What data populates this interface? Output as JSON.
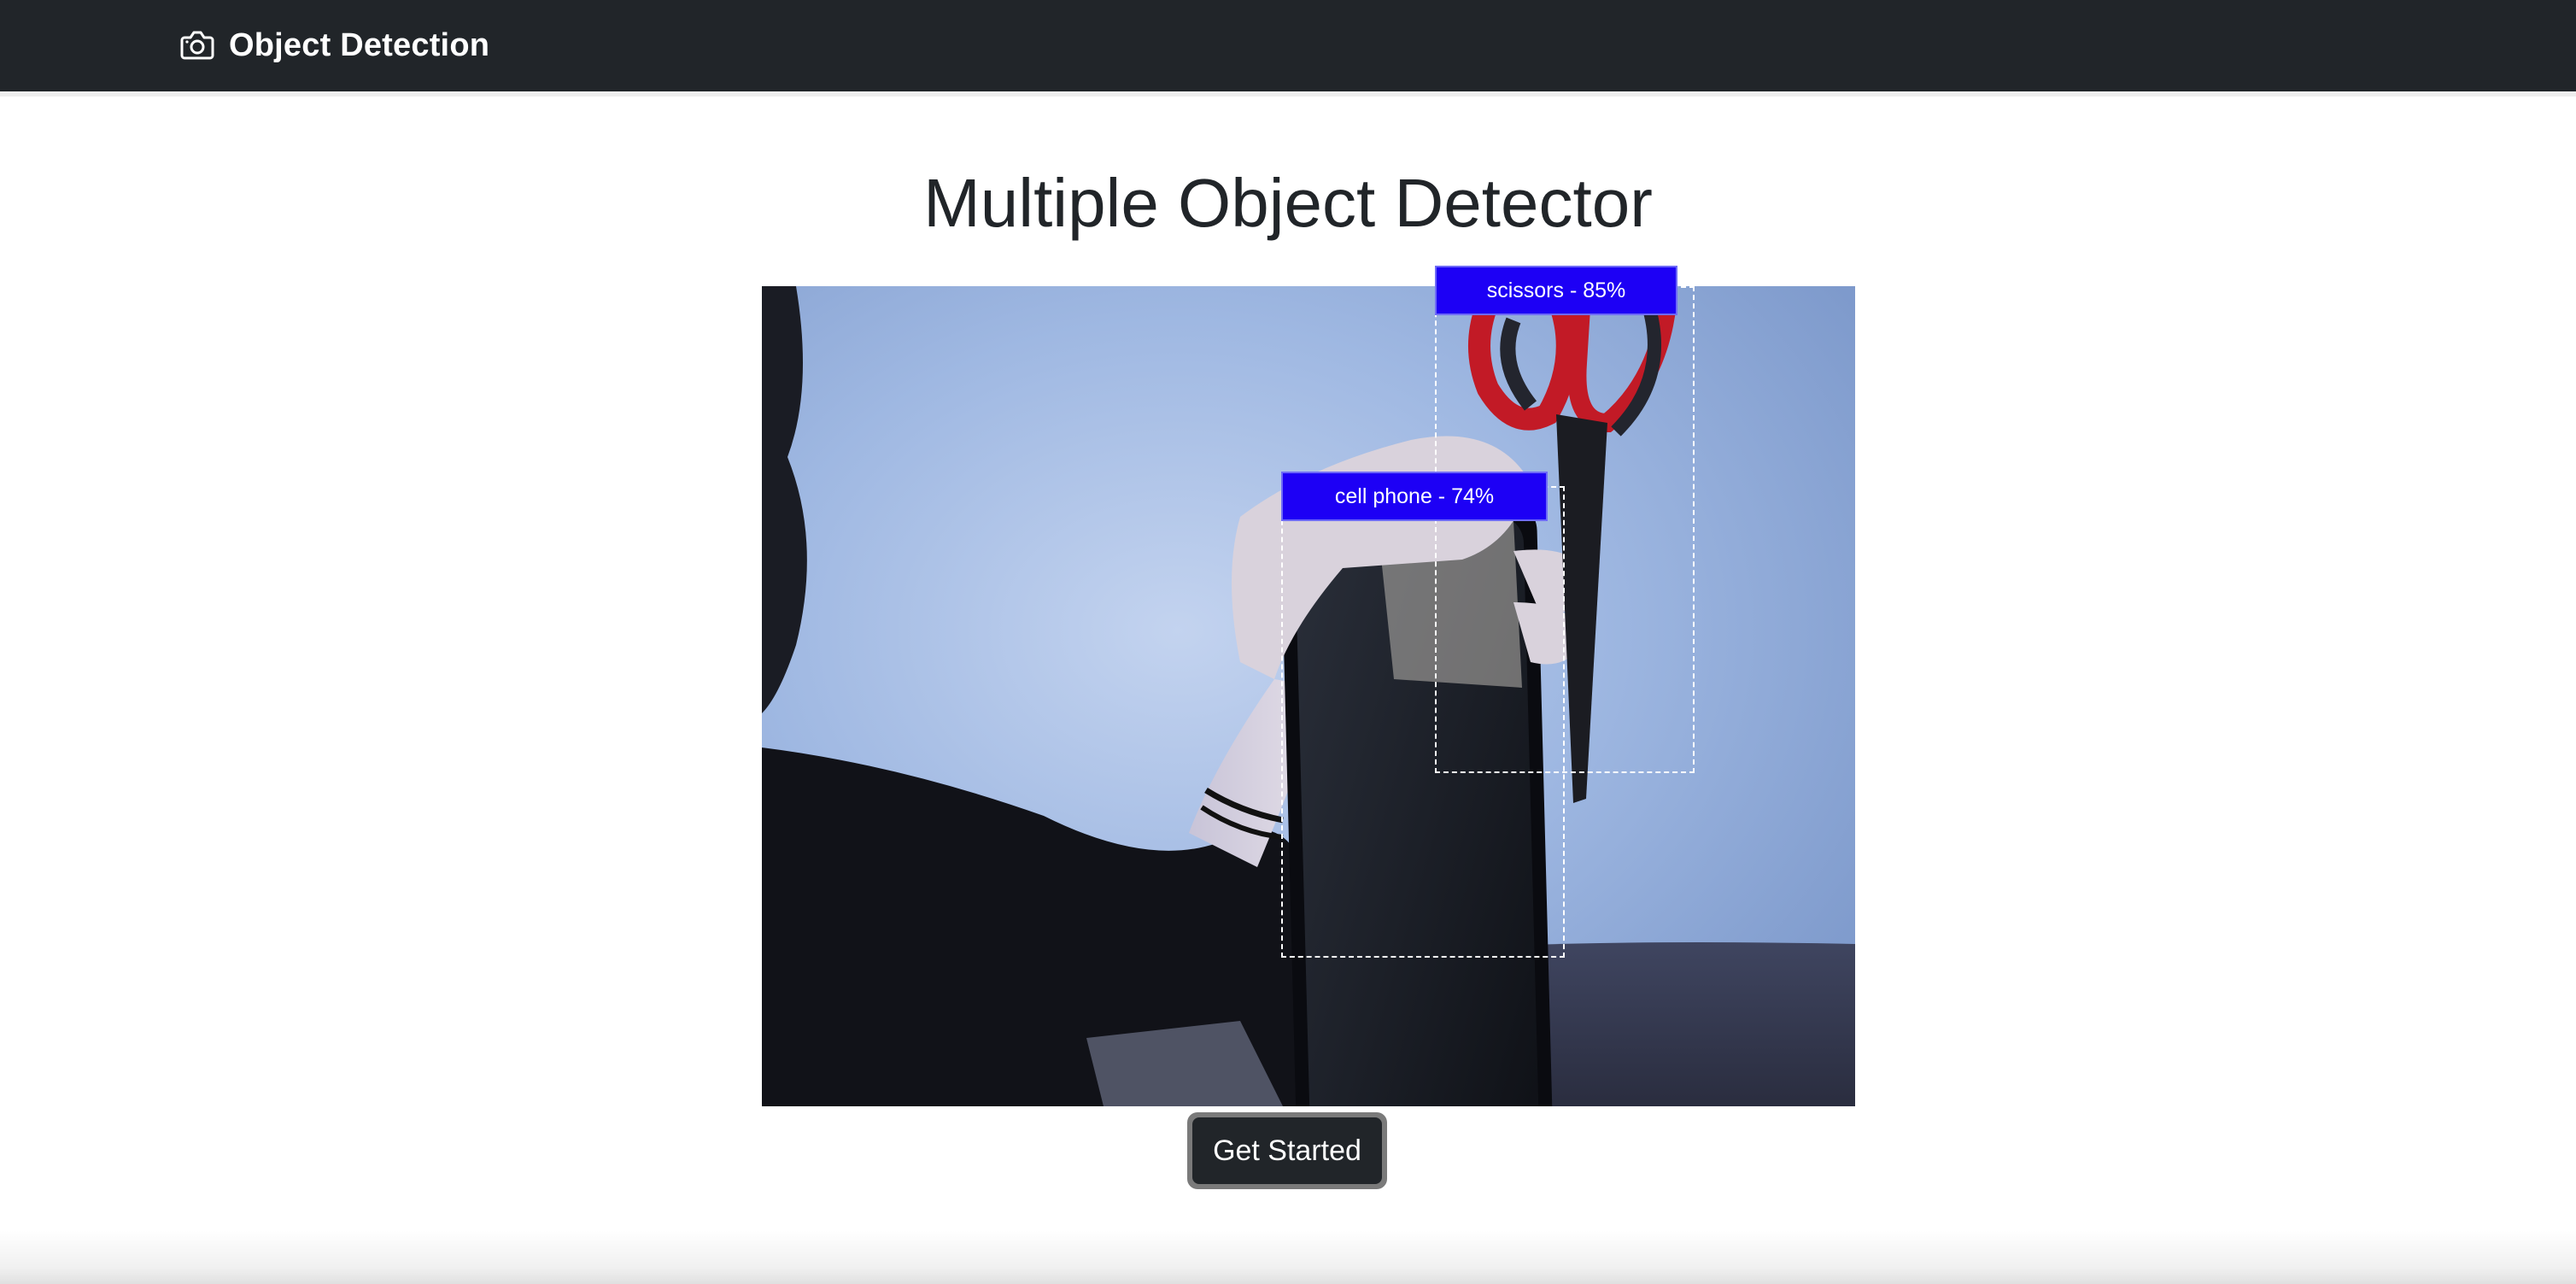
{
  "navbar": {
    "brand_icon": "camera-icon",
    "brand_text": "Object Detection",
    "background": "#212529"
  },
  "main": {
    "title": "Multiple Object Detector",
    "detections": [
      {
        "label": "scissors - 85%",
        "class": "scissors",
        "confidence": 85
      },
      {
        "label": "cell phone - 74%",
        "class": "cell phone",
        "confidence": 74
      }
    ],
    "label_color": "#1d00f5",
    "cta_label": "Get Started"
  }
}
